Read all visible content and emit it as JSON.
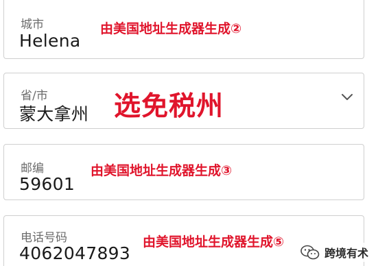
{
  "city": {
    "label": "城市",
    "value": "Helena",
    "annotation": "由美国地址生成器生成②"
  },
  "state": {
    "label": "省/市",
    "value": "蒙大拿州",
    "annotation": "选免税州",
    "dropdown_icon": "chevron-down-icon"
  },
  "zip": {
    "label": "邮编",
    "value": "59601",
    "annotation": "由美国地址生成器生成③"
  },
  "phone": {
    "label": "电话号码",
    "value": "4062047893",
    "annotation": "由美国地址生成器生成⑤"
  },
  "watermark": {
    "icon": "wechat-icon",
    "text": "跨境有术"
  },
  "colors": {
    "annotation": "#e0152c",
    "border": "#cfcfcf",
    "label": "#6b6b6b",
    "value": "#1a1a1a"
  }
}
